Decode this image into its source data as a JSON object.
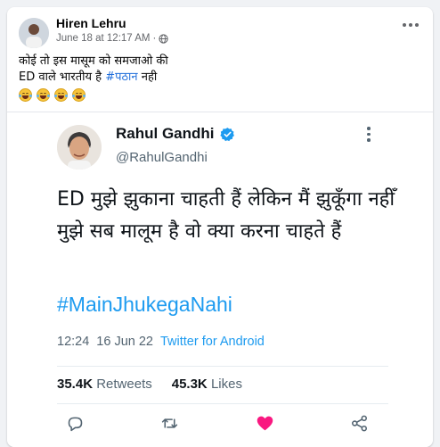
{
  "post": {
    "author": "Hiren Lehru",
    "timestamp": "June 18 at 12:17 AM",
    "separator": "·",
    "privacy_icon": "globe-icon",
    "caption_line1": "कोई तो इस मासूम को समजाओ की",
    "caption_line2_prefix": "ED वाले भारतीय है ",
    "caption_hashtag": "#पठान",
    "caption_line2_suffix": " नही",
    "emoji_count": 4,
    "emoji_name": "laughing-crying-emoji"
  },
  "tweet": {
    "name": "Rahul Gandhi",
    "handle": "@RahulGandhi",
    "text": "ED मुझे झुकाना चाहती हैं लेकिन मैं झुकूँगा नहीँ मुझे सब मालूम है वो क्या करना चाहते हैं",
    "hashtag": "#MainJhukegaNahi",
    "time": "12:24",
    "date": "16 Jun 22",
    "source": "Twitter for Android",
    "retweets_count": "35.4K",
    "retweets_label": "Retweets",
    "likes_count": "45.3K",
    "likes_label": "Likes",
    "colors": {
      "link": "#1d9bf0",
      "verified": "#1d9bf0",
      "like": "#f91880"
    }
  },
  "colors": {
    "page_bg": "#f0f2f5",
    "fb_hashtag": "#216fdb"
  }
}
